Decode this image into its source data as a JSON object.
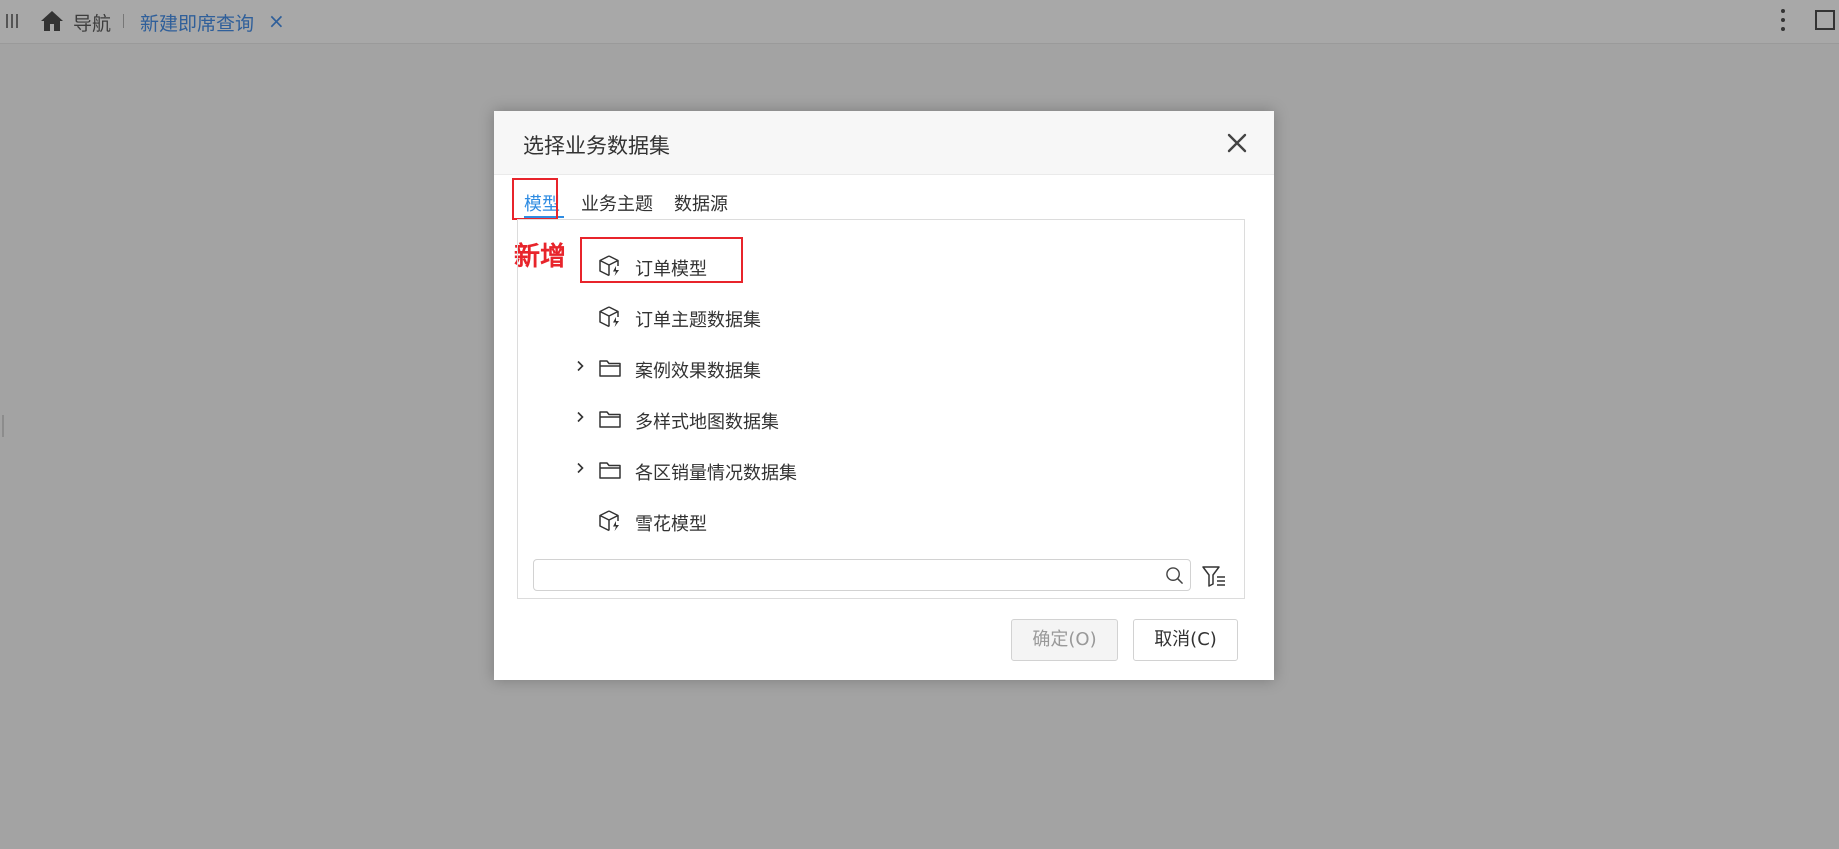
{
  "topbar": {
    "nav_label": "导航",
    "active_tab": "新建即席查询",
    "tab_close": "×"
  },
  "dialog": {
    "title": "选择业务数据集",
    "tabs": [
      {
        "label": "模型",
        "active": true
      },
      {
        "label": "业务主题",
        "active": false
      },
      {
        "label": "数据源",
        "active": false
      }
    ],
    "annotation": "新增",
    "tree": [
      {
        "label": "订单模型",
        "icon": "model-cube-icon",
        "expandable": false
      },
      {
        "label": "订单主题数据集",
        "icon": "model-cube-icon",
        "expandable": false
      },
      {
        "label": "案例效果数据集",
        "icon": "folder-icon",
        "expandable": true
      },
      {
        "label": "多样式地图数据集",
        "icon": "folder-icon",
        "expandable": true
      },
      {
        "label": "各区销量情况数据集",
        "icon": "folder-icon",
        "expandable": true
      },
      {
        "label": "雪花模型",
        "icon": "model-cube-icon",
        "expandable": false
      }
    ],
    "search": {
      "value": "",
      "placeholder": ""
    },
    "buttons": {
      "ok": "确定(O)",
      "cancel": "取消(C)"
    }
  },
  "colors": {
    "accent": "#2f8ce2",
    "highlight": "#e8242b",
    "overlay": "#a3a3a3"
  }
}
